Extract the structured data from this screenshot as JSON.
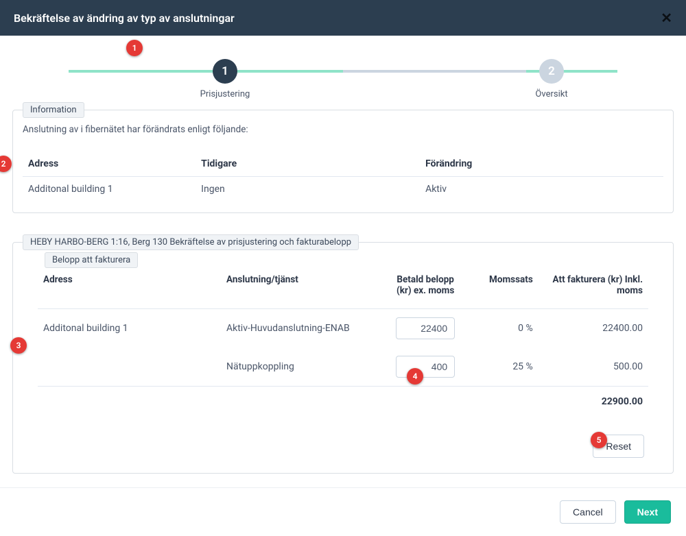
{
  "header": {
    "title": "Bekräftelse av ändring av typ av anslutningar"
  },
  "stepper": {
    "steps": [
      {
        "num": "1",
        "label": "Prisjustering",
        "state": "active"
      },
      {
        "num": "2",
        "label": "Översikt",
        "state": "inactive"
      }
    ]
  },
  "annotations": [
    "1",
    "2",
    "3",
    "4",
    "5"
  ],
  "info_box": {
    "legend": "Information",
    "intro": "Anslutning av i fibernätet har förändrats enligt följande:",
    "cols": [
      "Adress",
      "Tidigare",
      "Förändring"
    ],
    "rows": [
      {
        "adress": "Additonal building 1",
        "tidigare": "Ingen",
        "forandring": "Aktiv"
      }
    ]
  },
  "billing_box": {
    "legend": "HEBY HARBO-BERG 1:16, Berg 130 Bekräftelse av prisjustering och fakturabelopp",
    "inner_legend": "Belopp att fakturera",
    "cols": {
      "adress": "Adress",
      "service": "Anslutning/tjänst",
      "paid": "Betald belopp (kr) ex. moms",
      "vat": "Momssats",
      "invoice": "Att fakturera (kr) Inkl. moms"
    },
    "rows": [
      {
        "adress": "Additonal building 1",
        "service": "Aktiv-Huvudanslutning-ENAB",
        "paid": "22400",
        "vat": "0 %",
        "invoice": "22400.00"
      },
      {
        "adress": "",
        "service": "Nätuppkoppling",
        "paid": "400",
        "vat": "25 %",
        "invoice": "500.00"
      }
    ],
    "total": "22900.00",
    "reset_label": "Reset"
  },
  "footer": {
    "cancel": "Cancel",
    "next": "Next"
  }
}
